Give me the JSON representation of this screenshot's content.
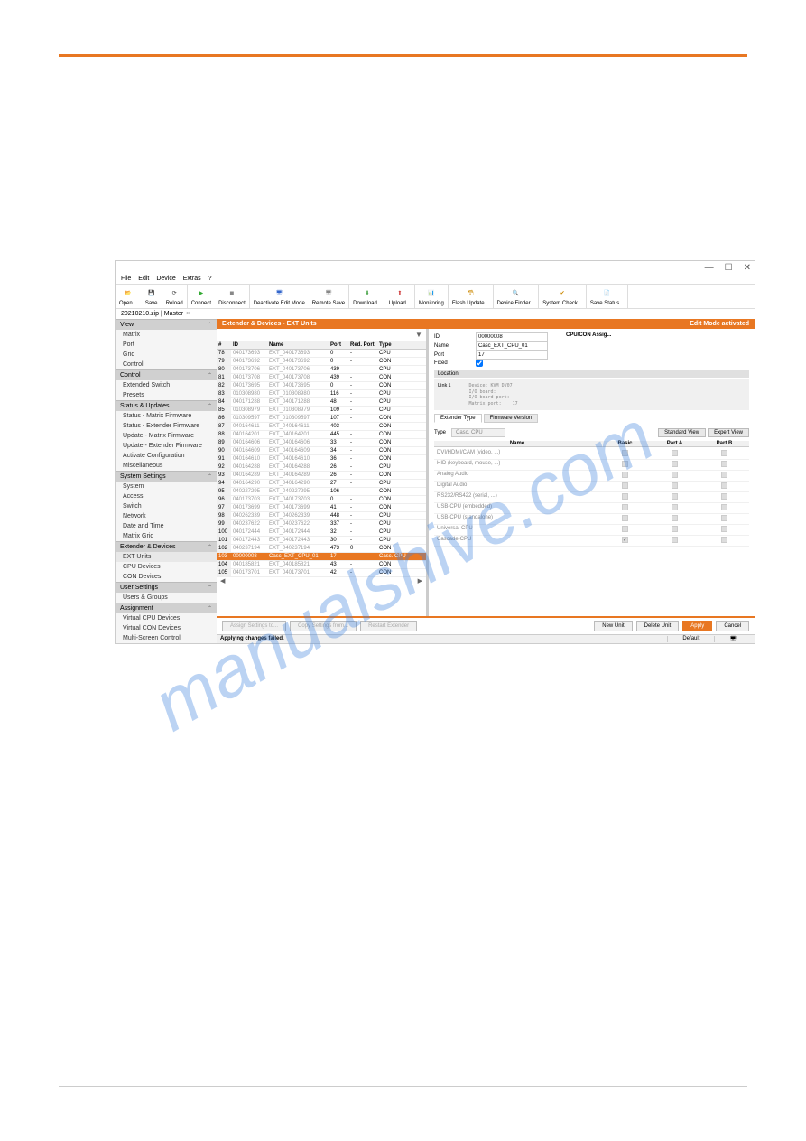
{
  "watermark": "manualshive.com",
  "window": {
    "menus": [
      "File",
      "Edit",
      "Device",
      "Extras",
      "?"
    ],
    "toolbar": [
      {
        "label": "Open...",
        "icon": "open-icon",
        "color": "#e87722"
      },
      {
        "label": "Save",
        "icon": "save-icon",
        "color": "#444"
      },
      {
        "label": "Reload",
        "icon": "reload-icon",
        "color": "#444"
      },
      {
        "label": "Connect",
        "icon": "connect-icon",
        "color": "#3a3"
      },
      {
        "label": "Disconnect",
        "icon": "disconnect-icon",
        "color": "#888"
      },
      {
        "label": "Deactivate Edit Mode",
        "icon": "edit-icon",
        "color": "#36c"
      },
      {
        "label": "Remote Save",
        "icon": "remote-save-icon",
        "color": "#888"
      },
      {
        "label": "Download...",
        "icon": "download-icon",
        "color": "#393"
      },
      {
        "label": "Upload...",
        "icon": "upload-icon",
        "color": "#c33"
      },
      {
        "label": "Monitoring",
        "icon": "monitor-icon",
        "color": "#333"
      },
      {
        "label": "Flash Update...",
        "icon": "flash-icon",
        "color": "#c80"
      },
      {
        "label": "Device Finder...",
        "icon": "finder-icon",
        "color": "#36c"
      },
      {
        "label": "System Check...",
        "icon": "check-icon",
        "color": "#c80"
      },
      {
        "label": "Save Status...",
        "icon": "status-icon",
        "color": "#888"
      }
    ],
    "tab": "20210210.zip | Master",
    "tab_close": "×"
  },
  "sidebar": {
    "sections": [
      {
        "title": "View",
        "collapsed": false,
        "items": [
          "Matrix",
          "Port",
          "Grid",
          "Control"
        ]
      },
      {
        "title": "Control",
        "collapsed": false,
        "items": [
          "Extended Switch",
          "Presets"
        ]
      },
      {
        "title": "Status & Updates",
        "collapsed": false,
        "items": [
          "Status - Matrix Firmware",
          "Status - Extender Firmware",
          "Update - Matrix Firmware",
          "Update - Extender Firmware",
          "Activate Configuration",
          "Miscellaneous"
        ]
      },
      {
        "title": "System Settings",
        "collapsed": false,
        "items": [
          "System",
          "Access",
          "Switch",
          "Network",
          "Date and Time",
          "Matrix Grid"
        ]
      },
      {
        "title": "Extender & Devices",
        "collapsed": false,
        "active": true,
        "items": [
          "EXT Units",
          "CPU Devices",
          "CON Devices"
        ],
        "active_item": 0
      },
      {
        "title": "User Settings",
        "collapsed": false,
        "items": [
          "Users & Groups"
        ]
      },
      {
        "title": "Assignment",
        "collapsed": false,
        "items": [
          "Virtual CPU Devices",
          "Virtual CON Devices",
          "Multi-Screen Control"
        ]
      }
    ]
  },
  "main": {
    "title": "Extender & Devices - EXT Units",
    "mode": "Edit Mode activated",
    "columns": [
      "#",
      "ID",
      "Name",
      "Port",
      "Red. Port",
      "Type"
    ],
    "rows": [
      {
        "n": "78",
        "id": "040173693",
        "name": "EXT_040173693",
        "port": "0",
        "red": "-",
        "type": "CPU"
      },
      {
        "n": "79",
        "id": "040173692",
        "name": "EXT_040173692",
        "port": "0",
        "red": "-",
        "type": "CON"
      },
      {
        "n": "80",
        "id": "040173706",
        "name": "EXT_040173706",
        "port": "439",
        "red": "-",
        "type": "CPU"
      },
      {
        "n": "81",
        "id": "040173708",
        "name": "EXT_040173708",
        "port": "439",
        "red": "-",
        "type": "CON"
      },
      {
        "n": "82",
        "id": "040173695",
        "name": "EXT_040173695",
        "port": "0",
        "red": "-",
        "type": "CON"
      },
      {
        "n": "83",
        "id": "010308980",
        "name": "EXT_010308980",
        "port": "116",
        "red": "-",
        "type": "CPU"
      },
      {
        "n": "84",
        "id": "040171288",
        "name": "EXT_040171288",
        "port": "48",
        "red": "-",
        "type": "CPU"
      },
      {
        "n": "85",
        "id": "010308979",
        "name": "EXT_010308979",
        "port": "109",
        "red": "-",
        "type": "CPU"
      },
      {
        "n": "86",
        "id": "010309597",
        "name": "EXT_010309597",
        "port": "107",
        "red": "-",
        "type": "CON"
      },
      {
        "n": "87",
        "id": "040164611",
        "name": "EXT_040164611",
        "port": "403",
        "red": "-",
        "type": "CON"
      },
      {
        "n": "88",
        "id": "040164201",
        "name": "EXT_040164201",
        "port": "445",
        "red": "-",
        "type": "CON"
      },
      {
        "n": "89",
        "id": "040164606",
        "name": "EXT_040164606",
        "port": "33",
        "red": "-",
        "type": "CON"
      },
      {
        "n": "90",
        "id": "040164609",
        "name": "EXT_040164609",
        "port": "34",
        "red": "-",
        "type": "CON"
      },
      {
        "n": "91",
        "id": "040164610",
        "name": "EXT_040164610",
        "port": "36",
        "red": "-",
        "type": "CON"
      },
      {
        "n": "92",
        "id": "040164288",
        "name": "EXT_040164288",
        "port": "26",
        "red": "-",
        "type": "CPU"
      },
      {
        "n": "93",
        "id": "040164289",
        "name": "EXT_040164289",
        "port": "26",
        "red": "-",
        "type": "CON"
      },
      {
        "n": "94",
        "id": "040164290",
        "name": "EXT_040164290",
        "port": "27",
        "red": "-",
        "type": "CPU"
      },
      {
        "n": "95",
        "id": "040227295",
        "name": "EXT_040227295",
        "port": "106",
        "red": "-",
        "type": "CON"
      },
      {
        "n": "96",
        "id": "040173703",
        "name": "EXT_040173703",
        "port": "0",
        "red": "-",
        "type": "CON"
      },
      {
        "n": "97",
        "id": "040173699",
        "name": "EXT_040173699",
        "port": "41",
        "red": "-",
        "type": "CON"
      },
      {
        "n": "98",
        "id": "040262339",
        "name": "EXT_040262339",
        "port": "448",
        "red": "-",
        "type": "CPU"
      },
      {
        "n": "99",
        "id": "040237622",
        "name": "EXT_040237622",
        "port": "337",
        "red": "-",
        "type": "CPU"
      },
      {
        "n": "100",
        "id": "040172444",
        "name": "EXT_040172444",
        "port": "32",
        "red": "-",
        "type": "CPU"
      },
      {
        "n": "101",
        "id": "040172443",
        "name": "EXT_040172443",
        "port": "30",
        "red": "-",
        "type": "CPU"
      },
      {
        "n": "102",
        "id": "040237194",
        "name": "EXT_040237194",
        "port": "473",
        "red": "0",
        "type": "CON"
      },
      {
        "n": "103",
        "id": "00000008",
        "name": "Casc_EXT_CPU_01",
        "port": "17",
        "red": "",
        "type": "Casc. CPU",
        "selected": true
      },
      {
        "n": "104",
        "id": "040185821",
        "name": "EXT_040185821",
        "port": "43",
        "red": "-",
        "type": "CON"
      },
      {
        "n": "105",
        "id": "040173701",
        "name": "EXT_040173701",
        "port": "42",
        "red": "-",
        "type": "CON"
      }
    ]
  },
  "detail": {
    "id_label": "ID",
    "id": "00000008",
    "cpu_assign": "CPU/CON Assig...",
    "name_label": "Name",
    "name": "Casc_EXT_CPU_01",
    "port_label": "Port",
    "port": "17",
    "fixed_label": "Fixed",
    "fixed": true,
    "location_label": "Location",
    "link_label": "Link 1",
    "location_text": "Device: KVM_DV07\nI/O board:\nI/O board port:\nMatrix port:    17",
    "tabs": [
      "Extender Type",
      "Firmware Version"
    ],
    "type_label": "Type",
    "type_value": "Casc. CPU",
    "view_std": "Standard View",
    "view_exp": "Expert View",
    "feat_cols": [
      "Name",
      "Basic",
      "Part A",
      "Part B"
    ],
    "features": [
      {
        "name": "DVI/HDMI/CAM (video, ...)",
        "basic": false,
        "a": false,
        "b": false
      },
      {
        "name": "HID (keyboard, mouse, ...)",
        "basic": false,
        "a": false,
        "b": false
      },
      {
        "name": "Analog Audio",
        "basic": false,
        "a": false,
        "b": false
      },
      {
        "name": "Digital Audio",
        "basic": false,
        "a": false,
        "b": false
      },
      {
        "name": "RS232/RS422 (serial, ...)",
        "basic": false,
        "a": false,
        "b": false
      },
      {
        "name": "USB-CPU (embedded)",
        "basic": false,
        "a": false,
        "b": false
      },
      {
        "name": "USB-CPU (standalone)",
        "basic": false,
        "a": false,
        "b": false
      },
      {
        "name": "Universal-CPU",
        "basic": false,
        "a": false,
        "b": false
      },
      {
        "name": "Cascade-CPU",
        "basic": true,
        "a": false,
        "b": false
      }
    ]
  },
  "actions": {
    "assign": "Assign Settings to...",
    "copy": "Copy Settings from...",
    "restart": "Restart Extender",
    "new": "New Unit",
    "delete": "Delete Unit",
    "apply": "Apply",
    "cancel": "Cancel"
  },
  "status": {
    "msg": "Applying changes failed.",
    "default_label": "Default"
  }
}
